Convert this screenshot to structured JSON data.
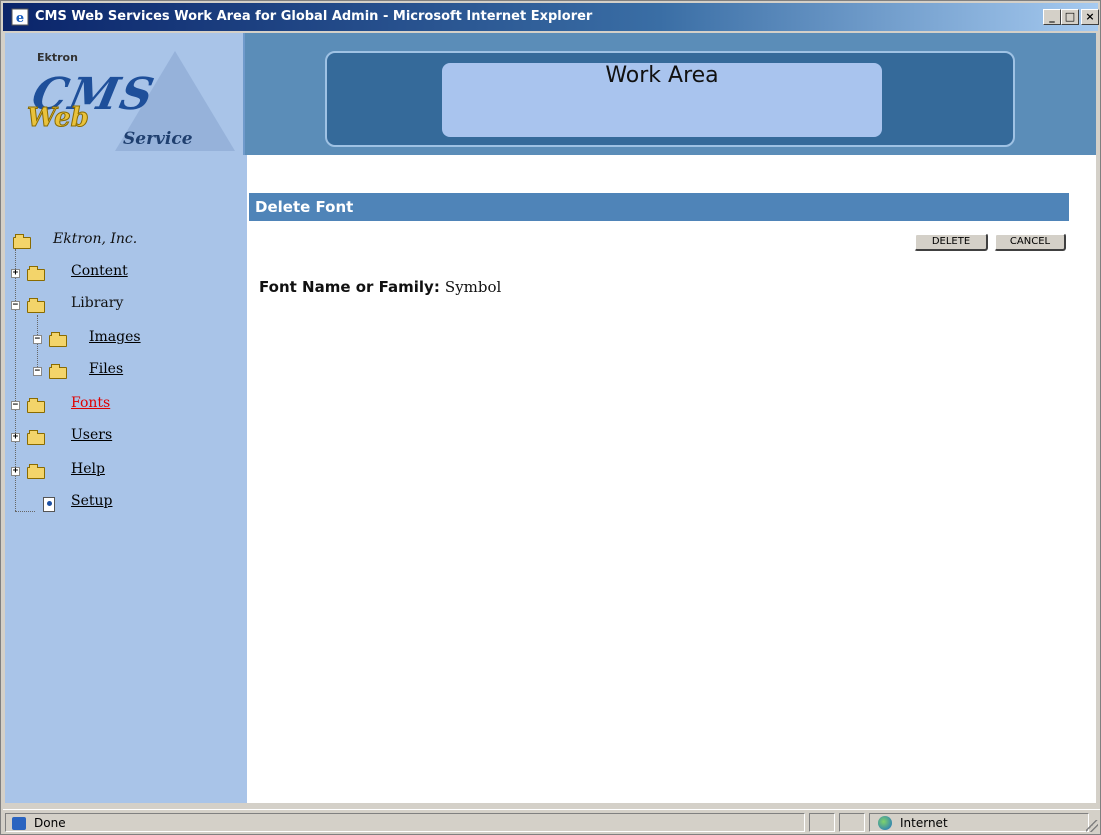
{
  "window": {
    "title": "CMS Web Services Work Area for Global Admin - Microsoft Internet Explorer",
    "controls": {
      "minimize": "_",
      "maximize": "□",
      "close": "×"
    }
  },
  "header": {
    "logo": {
      "brand": "Ektron",
      "cms": "CMS",
      "web": "Web",
      "service": "Service"
    },
    "banner": "Work Area"
  },
  "sidebar": {
    "items": [
      {
        "label": "Ektron, Inc.",
        "icon": "folder-open-icon"
      },
      {
        "label": "Content",
        "icon": "folder-icon",
        "expander": "+"
      },
      {
        "label": "Library",
        "icon": "folder-open-icon",
        "expander": "−"
      },
      {
        "label": "Images",
        "icon": "folder-open-icon",
        "expander": "−"
      },
      {
        "label": "Files",
        "icon": "folder-open-icon",
        "expander": "−"
      },
      {
        "label": "Fonts",
        "icon": "folder-open-icon",
        "expander": "−",
        "active": true
      },
      {
        "label": "Users",
        "icon": "folder-icon",
        "expander": "+"
      },
      {
        "label": "Help",
        "icon": "folder-icon",
        "expander": "+"
      },
      {
        "label": "Setup",
        "icon": "document-icon"
      }
    ]
  },
  "main": {
    "title": "Delete Font",
    "buttons": {
      "delete": "DELETE",
      "cancel": "CANCEL"
    },
    "field": {
      "label": "Font Name or Family:",
      "value": "Symbol"
    }
  },
  "statusbar": {
    "status": "Done",
    "zone": "Internet"
  },
  "colors": {
    "titlebar": "#0a246a",
    "sidebar_bg": "#a9c4e8",
    "panel_header": "#4f84b8",
    "active_link": "#e00000"
  }
}
